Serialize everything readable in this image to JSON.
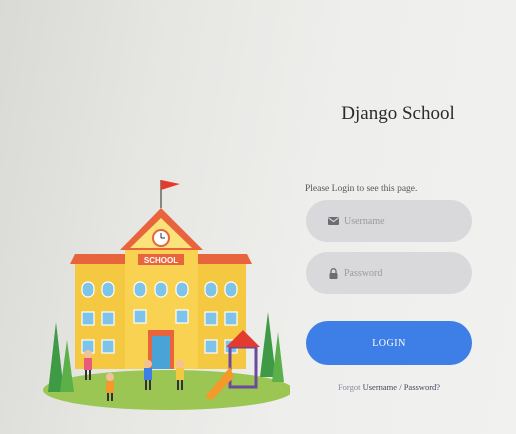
{
  "app": {
    "title": "Django School"
  },
  "login": {
    "prompt": "Please Login to see this page.",
    "username_placeholder": "Username",
    "password_placeholder": "Password",
    "button_label": "LOGIN",
    "forgot_prefix": "Forgot",
    "forgot_username": "Username",
    "forgot_separator": "/",
    "forgot_password": "Password?"
  },
  "illustration": {
    "sign_text": "SCHOOL"
  },
  "colors": {
    "accent": "#3d7fe6",
    "field_bg": "#d9d9db",
    "school_body": "#f5c842",
    "school_roof": "#e8643c",
    "flag": "#e43b2e"
  }
}
